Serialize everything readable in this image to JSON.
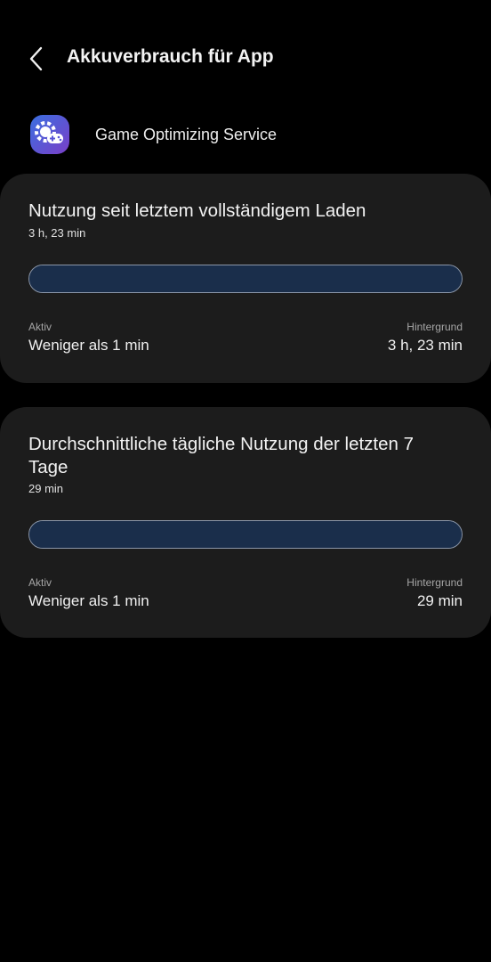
{
  "header": {
    "title": "Akkuverbrauch für App",
    "back_icon": "chevron-left-icon"
  },
  "app": {
    "name": "Game Optimizing Service",
    "icon": "game-gear-icon",
    "icon_colors": [
      "#3a6fe0",
      "#7a3fc8"
    ]
  },
  "cards": [
    {
      "title": "Nutzung seit letztem vollständigem Laden",
      "subtitle": "3 h, 23 min",
      "active_label": "Aktiv",
      "active_value": "Weniger als 1 min",
      "background_label": "Hintergrund",
      "background_value": "3 h, 23 min",
      "bar_fraction": 1.0
    },
    {
      "title": "Durchschnittliche tägliche Nutzung der letzten 7 Tage",
      "subtitle": "29 min",
      "active_label": "Aktiv",
      "active_value": "Weniger als 1 min",
      "background_label": "Hintergrund",
      "background_value": "29 min",
      "bar_fraction": 1.0
    }
  ],
  "colors": {
    "background": "#000000",
    "card": "#1c1c1c",
    "bar_fill": "#1a2e4b",
    "bar_border": "#8b96a8"
  }
}
